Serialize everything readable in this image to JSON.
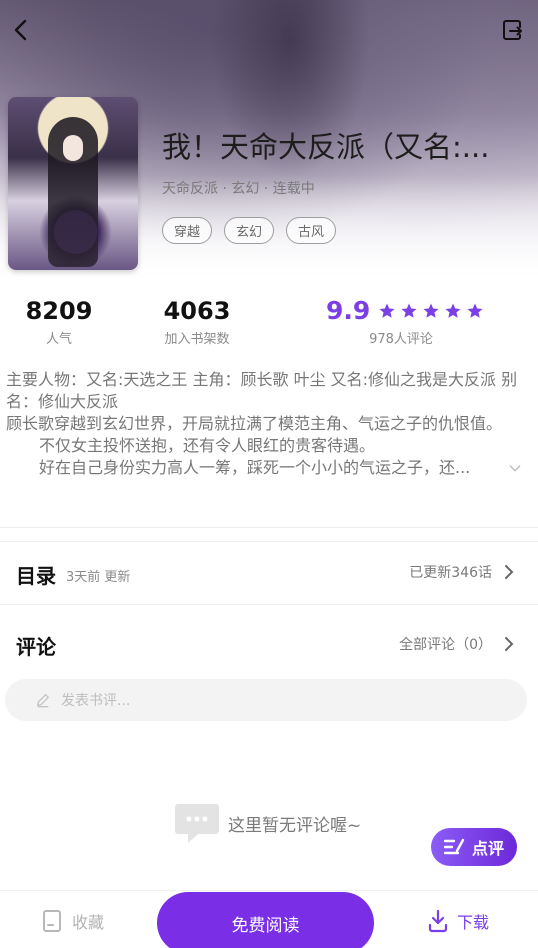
{
  "header": {
    "back_icon": "chevron-left-icon",
    "share_icon": "share-out-icon"
  },
  "book": {
    "title": "我！天命大反派（又名:...",
    "meta": "天命反派 · 玄幻 · 连载中",
    "tags": [
      "穿越",
      "玄幻",
      "古风"
    ]
  },
  "stats": {
    "popularity_value": "8209",
    "popularity_label": "人气",
    "shelf_value": "4063",
    "shelf_label": "加入书架数",
    "score": "9.9",
    "stars": 5,
    "reviews_label": "978人评论",
    "accent_color": "#7b3fe4"
  },
  "intro": {
    "line1": "主要人物：又名:天选之王 主角：顾长歌 叶尘 又名:修仙之我是大反派 别名：修仙大反派",
    "line2": "顾长歌穿越到玄幻世界，开局就拉满了模范主角、气运之子的仇恨值。",
    "line3": "不仅女主投怀送抱，还有令人眼红的贵客待遇。",
    "line4": "好在自己身份实力高人一筹，踩死一个小小的气运之子，还..."
  },
  "catalog": {
    "title": "目录",
    "updated": "3天前 更新",
    "count": "已更新346话"
  },
  "comments": {
    "title": "评论",
    "all_label": "全部评论（0）",
    "placeholder": "发表书评...",
    "empty_text": "这里暂无评论喔~"
  },
  "rate_button": {
    "label": "点评"
  },
  "bottom_bar": {
    "favorite_label": "收藏",
    "read_label": "免费阅读",
    "download_label": "下载"
  }
}
